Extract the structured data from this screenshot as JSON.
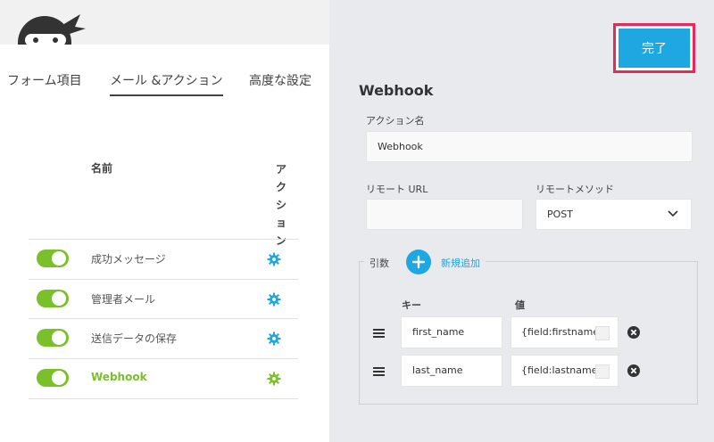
{
  "tabs": [
    {
      "label": "フォーム項目"
    },
    {
      "label": "メール &アクション"
    },
    {
      "label": "高度な設定"
    }
  ],
  "table": {
    "name_header": "名前",
    "action_header": [
      "ア",
      "ク",
      "シ",
      "ョ",
      "ン"
    ],
    "rows": [
      {
        "label": "成功メッセージ",
        "enabled": true
      },
      {
        "label": "管理者メール",
        "enabled": true
      },
      {
        "label": "送信データの保存",
        "enabled": true
      },
      {
        "label": "Webhook",
        "enabled": true
      }
    ]
  },
  "done_button": {
    "label": "完了"
  },
  "editor": {
    "title": "Webhook",
    "action_name_label": "アクション名",
    "action_name_value": "Webhook",
    "remote_url_label": "リモート URL",
    "remote_url_value": "",
    "remote_method_label": "リモートメソッド",
    "remote_method_value": "POST",
    "args_label": "引数",
    "add_new_label": "新規追加",
    "key_header": "キー",
    "value_header": "値",
    "args": [
      {
        "key": "first_name",
        "value": "{field:firstname"
      },
      {
        "key": "last_name",
        "value": "{field:lastname"
      }
    ]
  },
  "colors": {
    "accent": "#1ea7e1",
    "toggle_on": "#7ac02a",
    "highlight_box": "#e6295a"
  },
  "icons": {
    "logo": "ninja-logo",
    "row_action": "gear-icon",
    "drag": "drag-handle-icon",
    "delete": "remove-circle-icon",
    "add": "plus-icon",
    "select": "chevron-down-icon"
  }
}
